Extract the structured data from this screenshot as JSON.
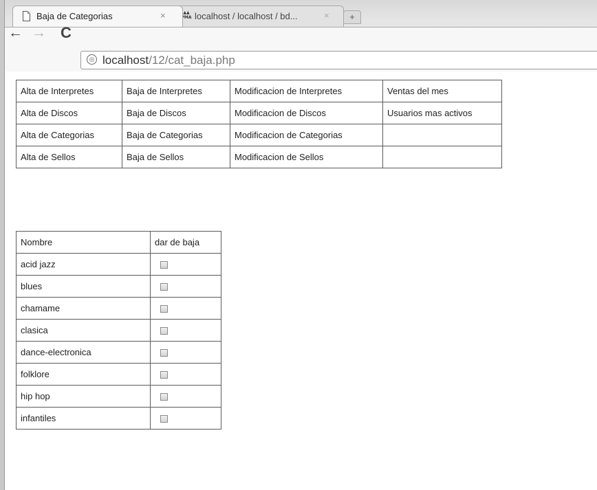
{
  "browser": {
    "tabs": [
      {
        "title": "Baja de Categorias",
        "close": "×",
        "active": true
      },
      {
        "title": "localhost / localhost / bd...",
        "close": "×",
        "active": false
      }
    ],
    "new_tab_label": "+",
    "nav": {
      "back": "←",
      "forward": "→",
      "reload": "C"
    },
    "url": {
      "host": "localhost",
      "path": "/12/cat_baja.php"
    }
  },
  "menu": {
    "rows": [
      [
        "Alta de Interpretes",
        "Baja de Interpretes",
        "Modificacion de Interpretes",
        "Ventas del mes"
      ],
      [
        "Alta de Discos",
        "Baja de Discos",
        "Modificacion de Discos",
        "Usuarios mas activos"
      ],
      [
        "Alta de Categorias",
        "Baja de Categorias",
        "Modificacion de Categorias",
        ""
      ],
      [
        "Alta de Sellos",
        "Baja de Sellos",
        "Modificacion de Sellos",
        ""
      ]
    ]
  },
  "categories": {
    "header": {
      "name": "Nombre",
      "action": "dar de baja"
    },
    "items": [
      {
        "name": "acid jazz",
        "checked": false
      },
      {
        "name": "blues",
        "checked": false
      },
      {
        "name": "chamame",
        "checked": false
      },
      {
        "name": "clasica",
        "checked": false
      },
      {
        "name": "dance-electronica",
        "checked": false
      },
      {
        "name": "folklore",
        "checked": false
      },
      {
        "name": "hip hop",
        "checked": false
      },
      {
        "name": "infantiles",
        "checked": false
      }
    ]
  }
}
